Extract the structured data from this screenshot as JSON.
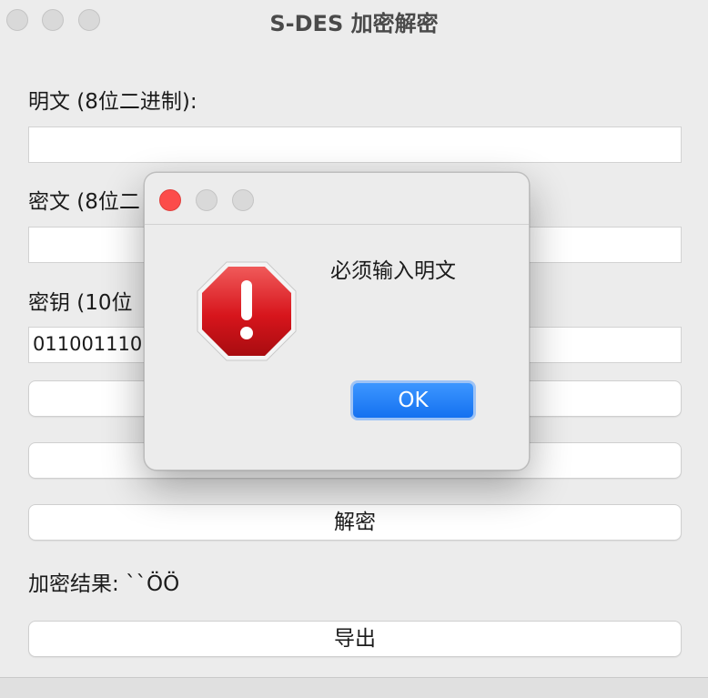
{
  "window": {
    "title": "S-DES 加密解密"
  },
  "form": {
    "plaintext_label": "明文 (8位二进制):",
    "plaintext_value": "",
    "ciphertext_label": "密文 (8位二",
    "ciphertext_value": "",
    "key_label": "密钥 (10位",
    "key_value": "011001110",
    "decrypt_button": "解密",
    "result_label": "加密结果: ``ÖÖ",
    "export_button": "导出"
  },
  "dialog": {
    "message": "必须输入明文",
    "ok_button": "OK",
    "icon": "stop-warning-icon"
  },
  "colors": {
    "accent": "#1471f0",
    "close_red": "#fc4c4a",
    "stop_red": "#d7151c"
  }
}
